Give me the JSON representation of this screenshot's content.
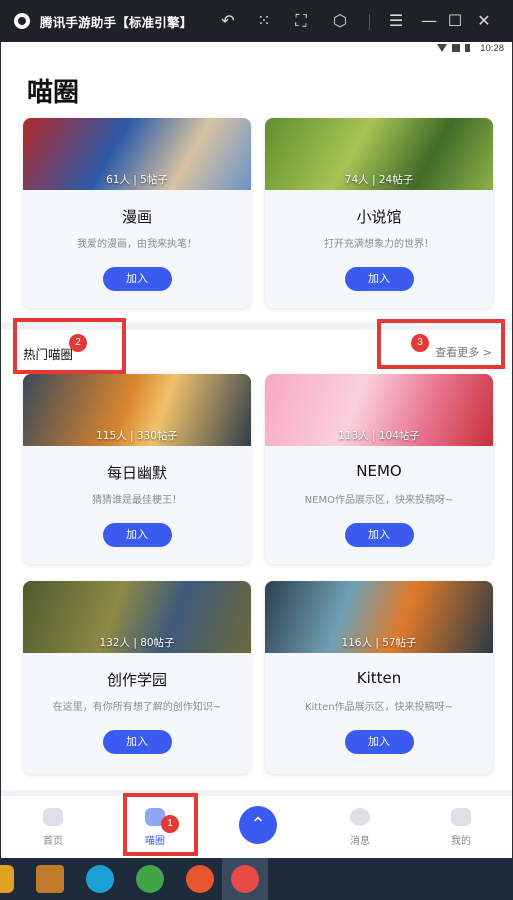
{
  "window": {
    "title": "腾讯手游助手【标准引擎】",
    "controls": [
      "undo-icon",
      "keyboard-icon",
      "fullscreen-icon",
      "settings-icon",
      "menu-icon",
      "minimize-icon",
      "maximize-icon",
      "close-icon"
    ]
  },
  "statusbar": {
    "time": "10:28"
  },
  "page": {
    "title": "喵圈"
  },
  "top_cards": [
    {
      "stats": "61人 | 5帖子",
      "name": "漫画",
      "desc": "我爱的漫画，由我来执笔！",
      "join": "加入"
    },
    {
      "stats": "74人 | 24帖子",
      "name": "小说馆",
      "desc": "打开充满想象力的世界！",
      "join": "加入"
    }
  ],
  "hot": {
    "title": "热门喵圈",
    "more": "查看更多 >"
  },
  "hot_cards": [
    {
      "stats": "115人 | 330帖子",
      "name": "每日幽默",
      "desc": "猜猜谁是最佳梗王！",
      "join": "加入"
    },
    {
      "stats": "113人 | 104帖子",
      "name": "NEMO",
      "desc": "NEMO作品展示区，快来投稿呀~",
      "join": "加入"
    },
    {
      "stats": "132人 | 80帖子",
      "name": "创作学园",
      "desc": "在这里，有你所有想了解的创作知识~",
      "join": "加入"
    },
    {
      "stats": "116人 | 57帖子",
      "name": "Kitten",
      "desc": "Kitten作品展示区，快来投稿呀~",
      "join": "加入"
    }
  ],
  "annotations": {
    "a1": "1",
    "a2": "2",
    "a3": "3"
  },
  "bottom_nav": [
    {
      "label": "首页"
    },
    {
      "label": "喵圈"
    },
    {
      "label": "消息"
    },
    {
      "label": "我的"
    }
  ],
  "colors": {
    "accent": "#3a5af0",
    "annotation": "#e53935"
  }
}
